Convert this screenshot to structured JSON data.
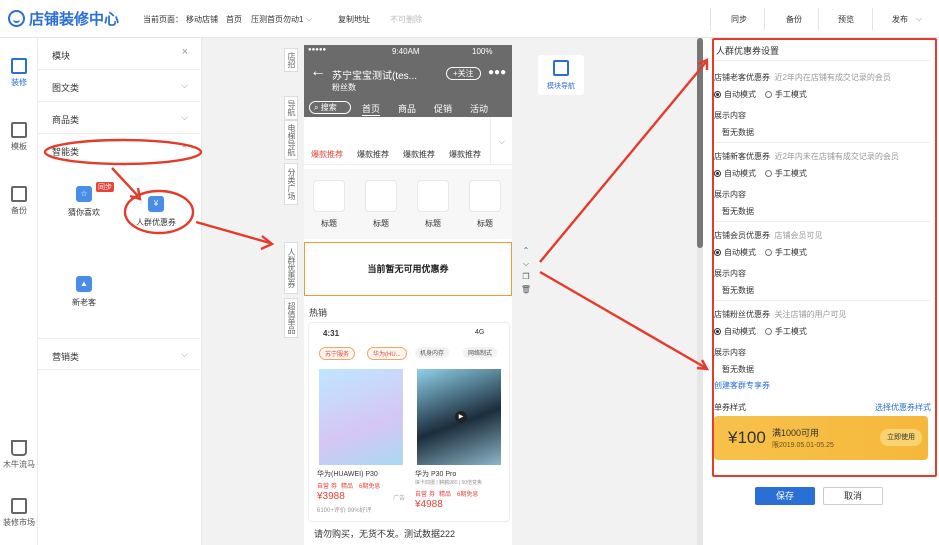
{
  "app": {
    "title": "店铺装修中心"
  },
  "breadcrumb": {
    "prefix": "当前页面：",
    "items": [
      "移动店铺",
      "首页",
      "压测首页勿动1"
    ]
  },
  "topbar": {
    "copy_link": "复制地址",
    "undeletable": "不可删除",
    "sync": "同步",
    "backup": "备份",
    "preview": "预览",
    "publish": "发布"
  },
  "rail": {
    "items": [
      {
        "label": "装修",
        "icon": "paint-roller-icon"
      },
      {
        "label": "模板",
        "icon": "template-icon"
      },
      {
        "label": "备份",
        "icon": "backup-icon"
      },
      {
        "label": "木牛流马",
        "icon": "cart-icon"
      },
      {
        "label": "装修市场",
        "icon": "market-icon"
      }
    ]
  },
  "modules": {
    "header": "模块",
    "groups": [
      "图文类",
      "商品类",
      "智能类",
      "营销类"
    ],
    "smart_items": [
      {
        "label": "猜你喜欢",
        "badge": "同步"
      },
      {
        "label": "人群优惠券"
      },
      {
        "label": "新老客"
      }
    ]
  },
  "canvas": {
    "side_labels": [
      "店招",
      "导航",
      "电梯导航",
      "分类广场",
      "人群优惠券",
      "超值单品"
    ],
    "nav_module": "模块导航"
  },
  "phone": {
    "carrier": "●●●●● ",
    "time": "9:40AM",
    "battery": "100%",
    "shop_name": "苏宁宝宝测试(tes...",
    "fans": "粉丝数",
    "follow": "+关注",
    "search": "搜索",
    "tabs": [
      "首页",
      "商品",
      "促销",
      "活动"
    ],
    "rec_tabs": [
      "爆款推荐",
      "爆款推荐",
      "爆款推荐",
      "爆款推荐"
    ],
    "tile_label": "标题",
    "coupon_empty": "当前暂无可用优惠券",
    "hot": "热销",
    "inner_time": "4:31",
    "inner_signal": "4G",
    "chips": [
      "苏宁服务",
      "华为(HU...",
      "机身内存",
      "网络制式"
    ],
    "products": [
      {
        "name": "华为(HUAWEI) P30",
        "tags": [
          "自营",
          "券",
          "精品",
          "6期免息"
        ],
        "price": "¥3988",
        "sub": "6100+评价  99%好评",
        "ad": "广告"
      },
      {
        "name": "华为 P30 Pro",
        "sub": "徕卡四摄 | 麒麟980 | 50倍变焦",
        "tags": [
          "自营",
          "券",
          "精品",
          "6期免息"
        ],
        "price": "¥4988"
      }
    ],
    "footer_text": "请勿购买，无货不发。测试数据222"
  },
  "settings": {
    "title": "人群优惠券设置",
    "sections": [
      {
        "title": "店铺老客优惠券",
        "note": "近2年内在店铺有成交记录的会员",
        "auto": "自动模式",
        "manual": "手工模式",
        "content_label": "展示内容",
        "content": "暂无数据"
      },
      {
        "title": "店铺新客优惠券",
        "note": "近2年内未在店铺有成交记录的会员",
        "auto": "自动模式",
        "manual": "手工模式",
        "content_label": "展示内容",
        "content": "暂无数据"
      },
      {
        "title": "店铺会员优惠券",
        "note": "店铺会员可见",
        "auto": "自动模式",
        "manual": "手工模式",
        "content_label": "展示内容",
        "content": "暂无数据"
      },
      {
        "title": "店铺粉丝优惠券",
        "note": "关注店铺的用户可见",
        "auto": "自动模式",
        "manual": "手工模式",
        "content_label": "展示内容",
        "content": "暂无数据"
      }
    ],
    "create_link": "创建客群专享券",
    "style_label": "单券样式",
    "style_select": "选择优惠券样式",
    "sample": {
      "amount": "¥100",
      "condition": "满1000可用",
      "date": "限2019.05.01-05.25",
      "use": "立即使用"
    },
    "save": "保存",
    "cancel": "取消"
  },
  "colors": {
    "accent": "#2a6fd6",
    "highlight": "#e43b2a",
    "coupon": "#f6b83c"
  }
}
